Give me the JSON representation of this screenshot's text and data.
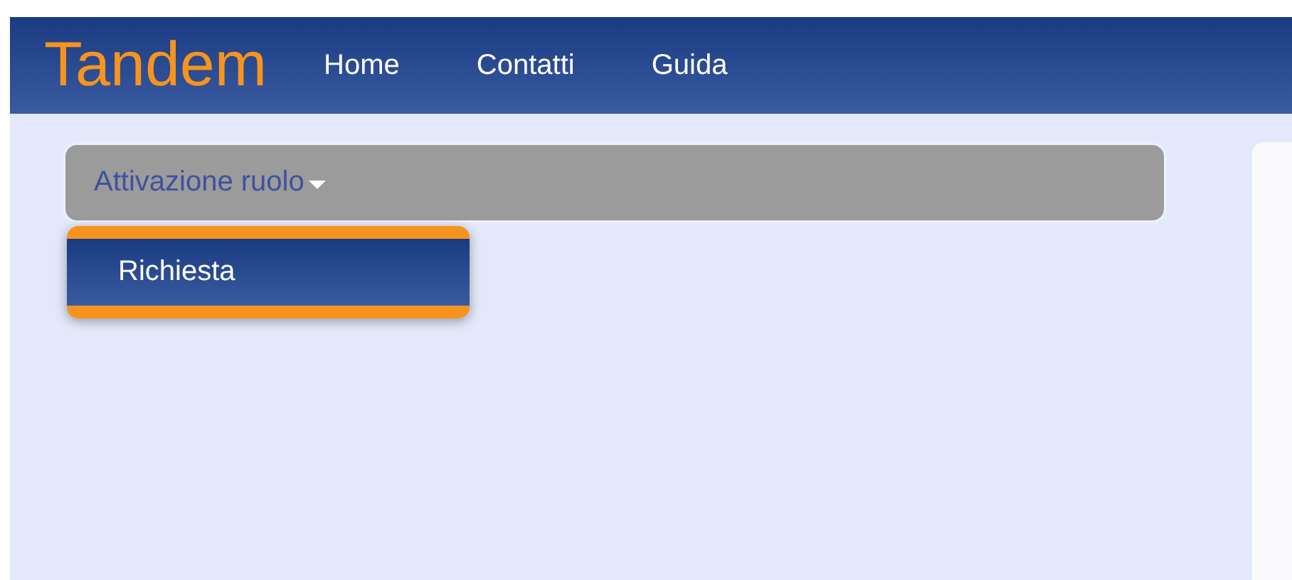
{
  "header": {
    "brand": "Tandem",
    "nav": [
      {
        "label": "Home"
      },
      {
        "label": "Contatti"
      },
      {
        "label": "Guida"
      }
    ]
  },
  "menu": {
    "label": "Attivazione ruolo",
    "expanded": true,
    "items": [
      {
        "label": "Richiesta"
      }
    ]
  }
}
